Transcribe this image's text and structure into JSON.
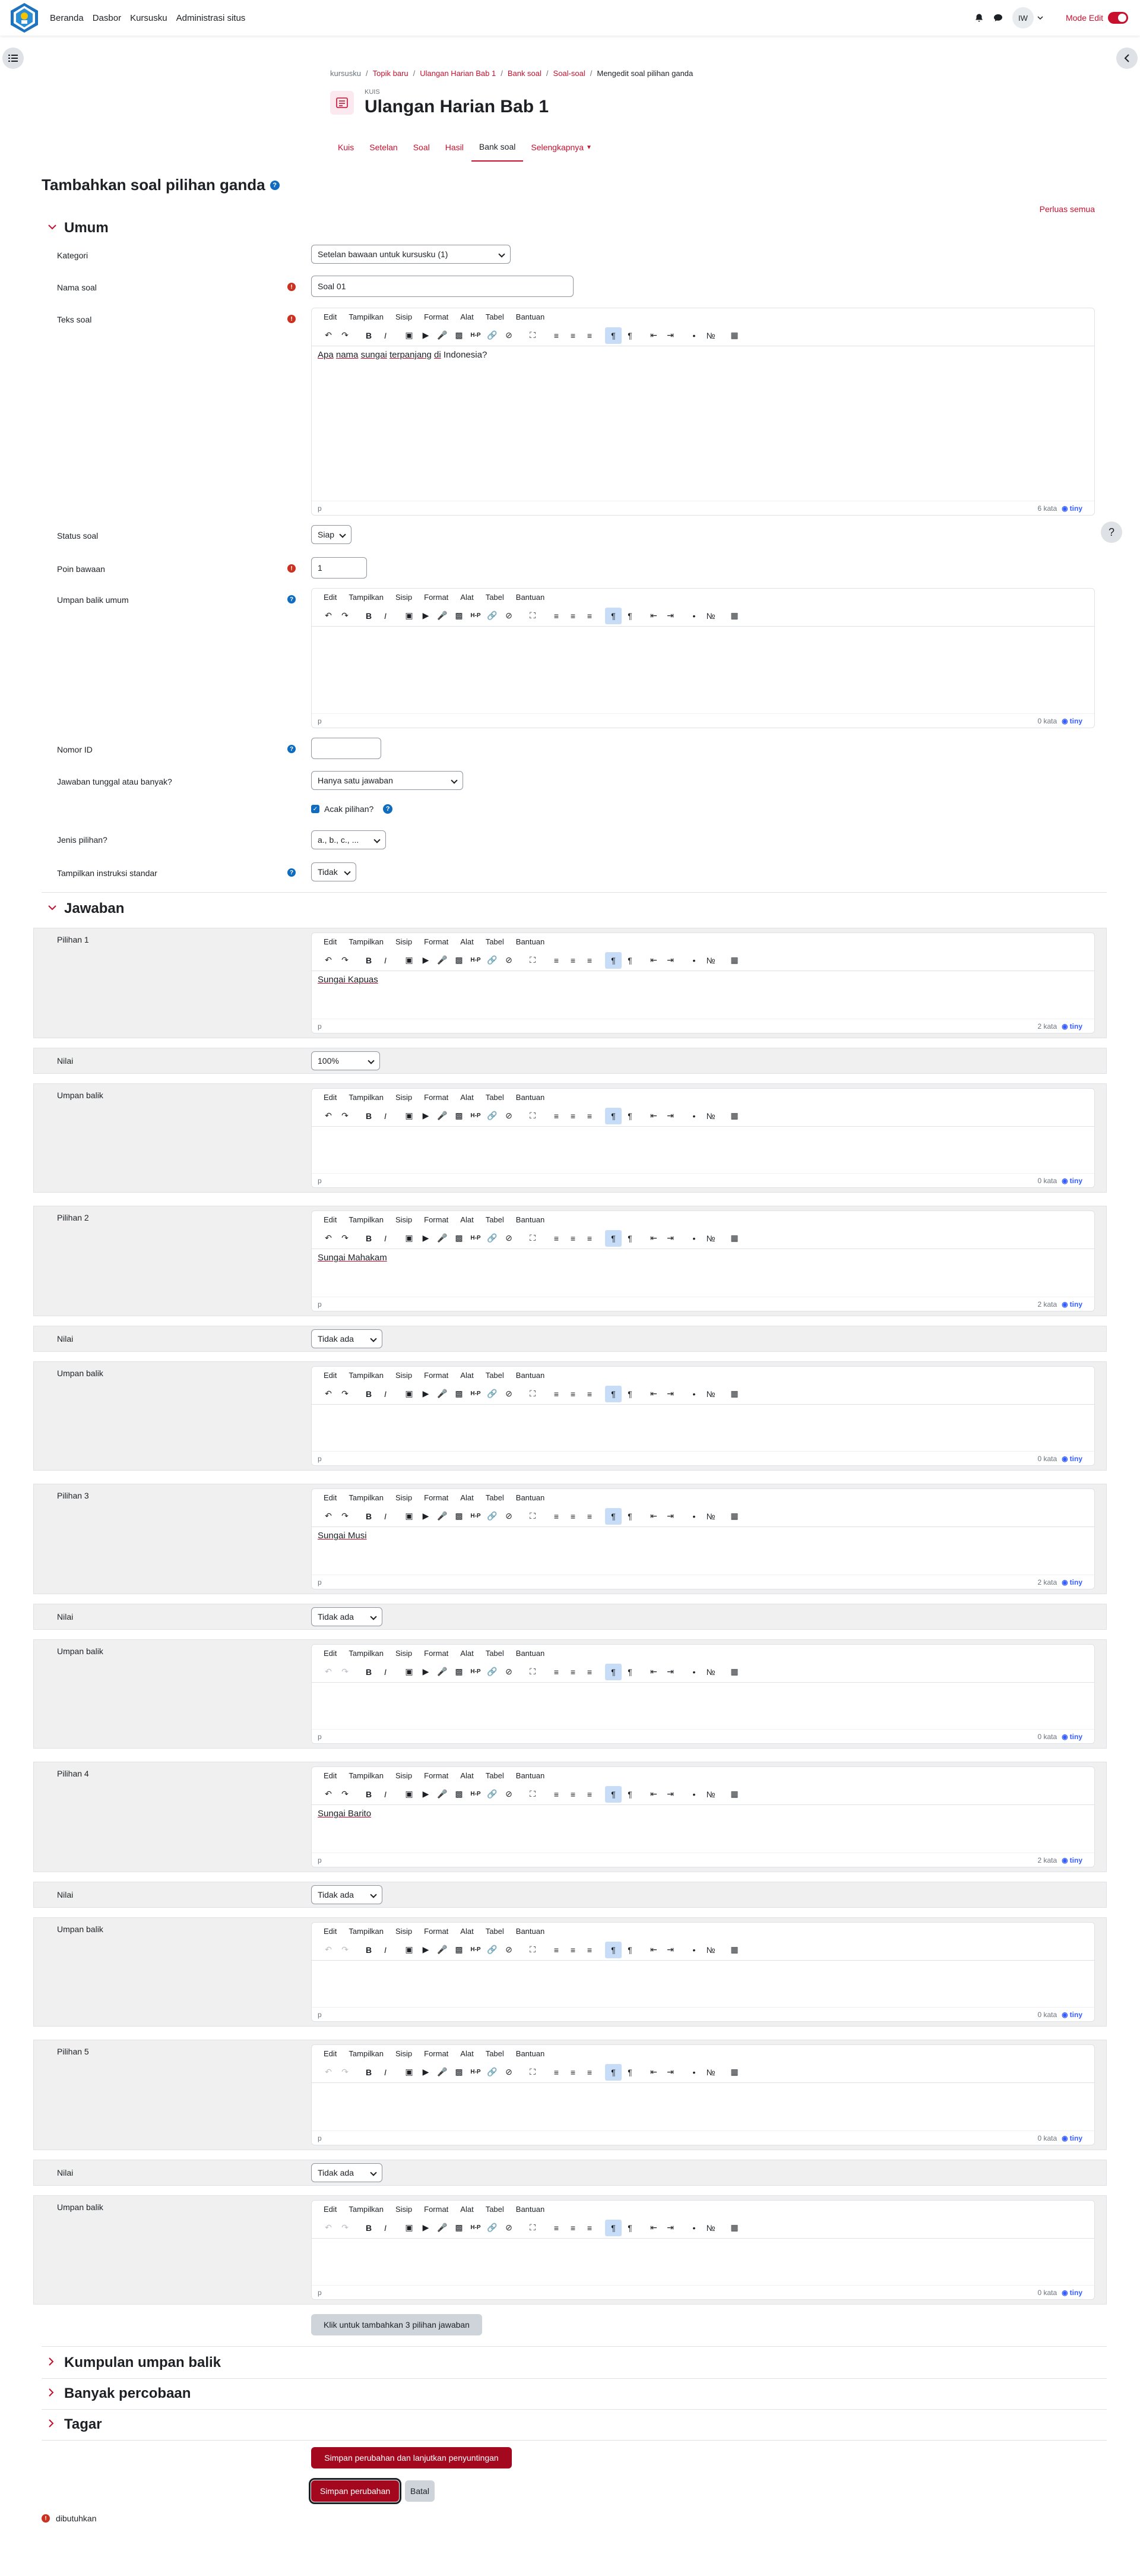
{
  "nav": {
    "links": [
      "Beranda",
      "Dasbor",
      "Kursusku",
      "Administrasi situs"
    ],
    "avatar": "IW",
    "edit_mode": "Mode Edit"
  },
  "breadcrumb": [
    "kursusku",
    "Topik baru",
    "Ulangan Harian Bab 1",
    "Bank soal",
    "Soal-soal",
    "Mengedit soal pilihan ganda"
  ],
  "quiz": {
    "label": "KUIS",
    "title": "Ulangan Harian Bab 1"
  },
  "tabs": [
    "Kuis",
    "Setelan",
    "Soal",
    "Hasil",
    "Bank soal",
    "Selengkapnya"
  ],
  "page_title": "Tambahkan soal pilihan ganda",
  "expand_all": "Perluas semua",
  "sections": {
    "umum": "Umum",
    "jawaban": "Jawaban",
    "feedback": "Kumpulan umpan balik",
    "tries": "Banyak percobaan",
    "tags": "Tagar"
  },
  "fields": {
    "kategori_label": "Kategori",
    "kategori_value": "Setelan bawaan untuk kursusku (1)",
    "nama_label": "Nama soal",
    "nama_value": "Soal 01",
    "teks_label": "Teks soal",
    "teks_words": [
      "Apa",
      "nama",
      "sungai",
      "terpanjang",
      "di",
      "Indonesia?"
    ],
    "teks_count": "6 kata",
    "status_label": "Status soal",
    "status_value": "Siap",
    "poin_label": "Poin bawaan",
    "poin_value": "1",
    "umpan_umum_label": "Umpan balik umum",
    "umpan_umum_count": "0 kata",
    "nomor_label": "Nomor ID",
    "jawaban_label": "Jawaban tunggal atau banyak?",
    "jawaban_value": "Hanya satu jawaban",
    "acak_label": "Acak pilihan?",
    "jenis_label": "Jenis pilihan?",
    "jenis_value": "a., b., c., ...",
    "instruksi_label": "Tampilkan instruksi standar",
    "instruksi_value": "Tidak"
  },
  "editor": {
    "menu": [
      "Edit",
      "Tampilkan",
      "Sisip",
      "Format",
      "Alat",
      "Tabel",
      "Bantuan"
    ],
    "tag": "p",
    "brand": "tiny"
  },
  "choices": [
    {
      "label": "Pilihan 1",
      "text": "Sungai Kapuas",
      "count": "2 kata",
      "nilai_label": "Nilai",
      "nilai": "100%",
      "umpan_label": "Umpan balik",
      "umpan_count": "0 kata"
    },
    {
      "label": "Pilihan 2",
      "text": "Sungai Mahakam",
      "count": "2 kata",
      "nilai_label": "Nilai",
      "nilai": "Tidak ada",
      "umpan_label": "Umpan balik",
      "umpan_count": "0 kata"
    },
    {
      "label": "Pilihan 3",
      "text": "Sungai Musi",
      "count": "2 kata",
      "nilai_label": "Nilai",
      "nilai": "Tidak ada",
      "umpan_label": "Umpan balik",
      "umpan_count": "0 kata"
    },
    {
      "label": "Pilihan 4",
      "text": "Sungai Barito",
      "count": "2 kata",
      "nilai_label": "Nilai",
      "nilai": "Tidak ada",
      "umpan_label": "Umpan balik",
      "umpan_count": "0 kata"
    },
    {
      "label": "Pilihan 5",
      "text": "",
      "count": "0 kata",
      "nilai_label": "Nilai",
      "nilai": "Tidak ada",
      "umpan_label": "Umpan balik",
      "umpan_count": "0 kata"
    }
  ],
  "buttons": {
    "add_choices": "Klik untuk tambahkan 3 pilihan jawaban",
    "save_continue": "Simpan perubahan dan lanjutkan penyuntingan",
    "save": "Simpan perubahan",
    "cancel": "Batal"
  },
  "required_note": "dibutuhkan",
  "colors": {
    "brand": "#c8102e",
    "primary_button": "#a4081e",
    "link": "#0f6cbf"
  }
}
